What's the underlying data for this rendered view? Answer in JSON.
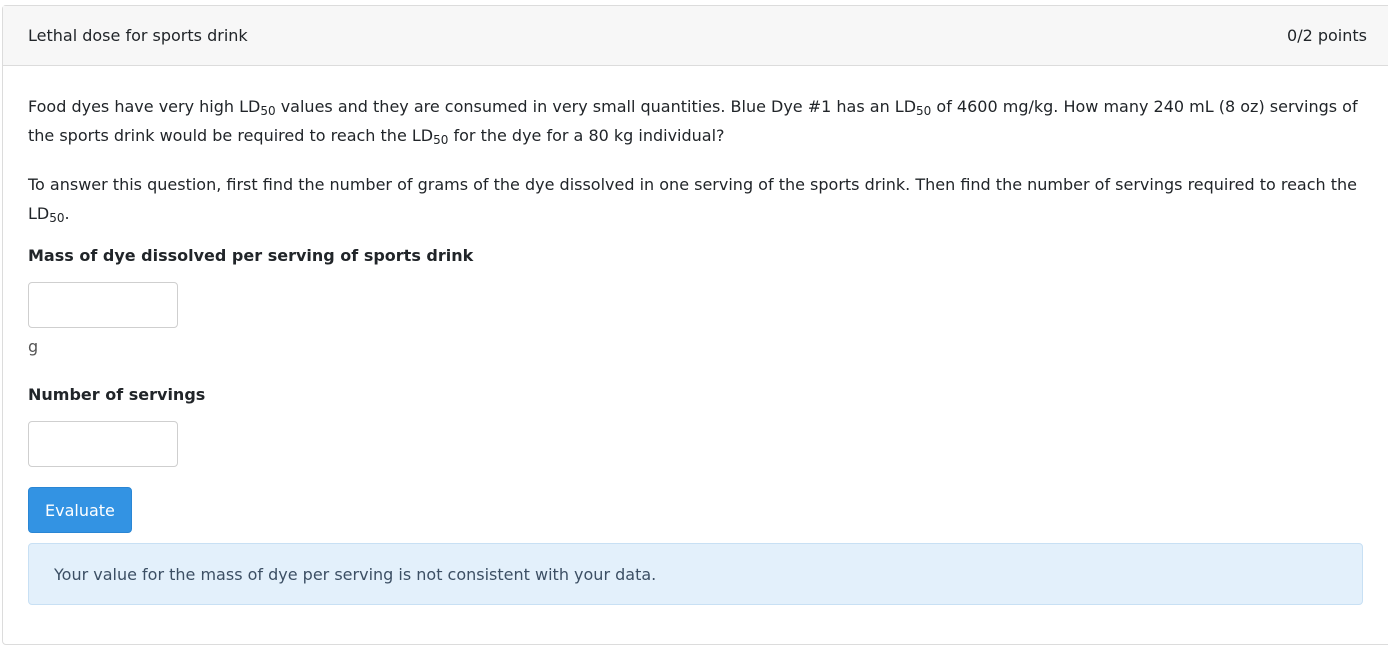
{
  "header": {
    "title": "Lethal dose for sports drink",
    "points": "0/2 points"
  },
  "question": {
    "p1_a": "Food dyes have very high LD",
    "p1_sub1": "50",
    "p1_b": " values and they are consumed in very small quantities.  Blue Dye #1 has an LD",
    "p1_sub2": "50",
    "p1_c": " of 4600 mg/kg.  How many 240 mL (8 oz)  servings of the sports drink would be required to reach the LD",
    "p1_sub3": "50",
    "p1_d": " for the dye for a 80 kg individual?",
    "p2_a": "To answer this question, first find the number of grams of the dye dissolved in one serving of the sports drink.  Then find the number of servings required to reach the LD",
    "p2_sub": "50",
    "p2_b": "."
  },
  "fields": {
    "mass_label": "Mass of dye dissolved per serving of sports drink",
    "mass_value": "",
    "mass_unit": "g",
    "servings_label": "Number of servings",
    "servings_value": ""
  },
  "actions": {
    "evaluate_label": "Evaluate"
  },
  "feedback": {
    "message": "Your value for the mass of dye per serving is not consistent with your data."
  }
}
